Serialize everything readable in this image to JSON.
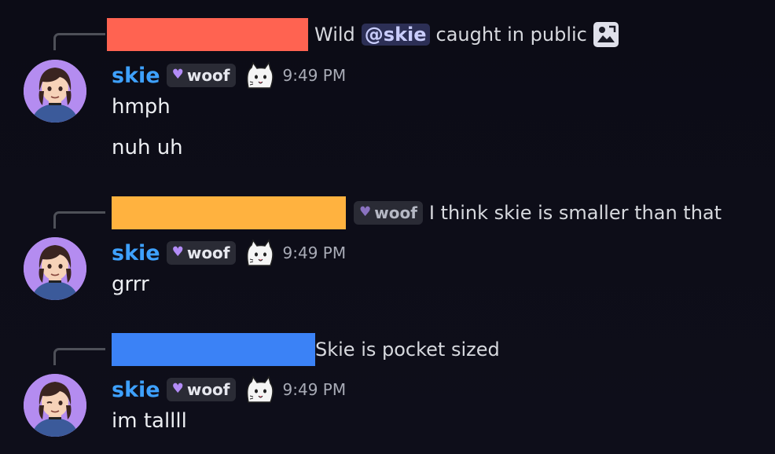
{
  "colors": {
    "redact_red": "#ff6351",
    "redact_orange": "#ffb23f",
    "redact_blue": "#3b82f6",
    "username": "#3ea1ff"
  },
  "messages": [
    {
      "reply": {
        "text_before": "Wild",
        "mention": "@skie",
        "text_after": "caught in public",
        "attachment_icon": "image-icon"
      },
      "author": "skie",
      "tag": "woof",
      "time": "9:49 PM",
      "lines": [
        "hmph",
        "nuh uh"
      ]
    },
    {
      "reply": {
        "tag": "woof",
        "text": "I think skie is smaller than that"
      },
      "author": "skie",
      "tag": "woof",
      "time": "9:49 PM",
      "lines": [
        "grrr"
      ]
    },
    {
      "reply": {
        "text": "Skie is pocket sized"
      },
      "author": "skie",
      "tag": "woof",
      "time": "9:49 PM",
      "lines": [
        "im tallll"
      ]
    }
  ]
}
